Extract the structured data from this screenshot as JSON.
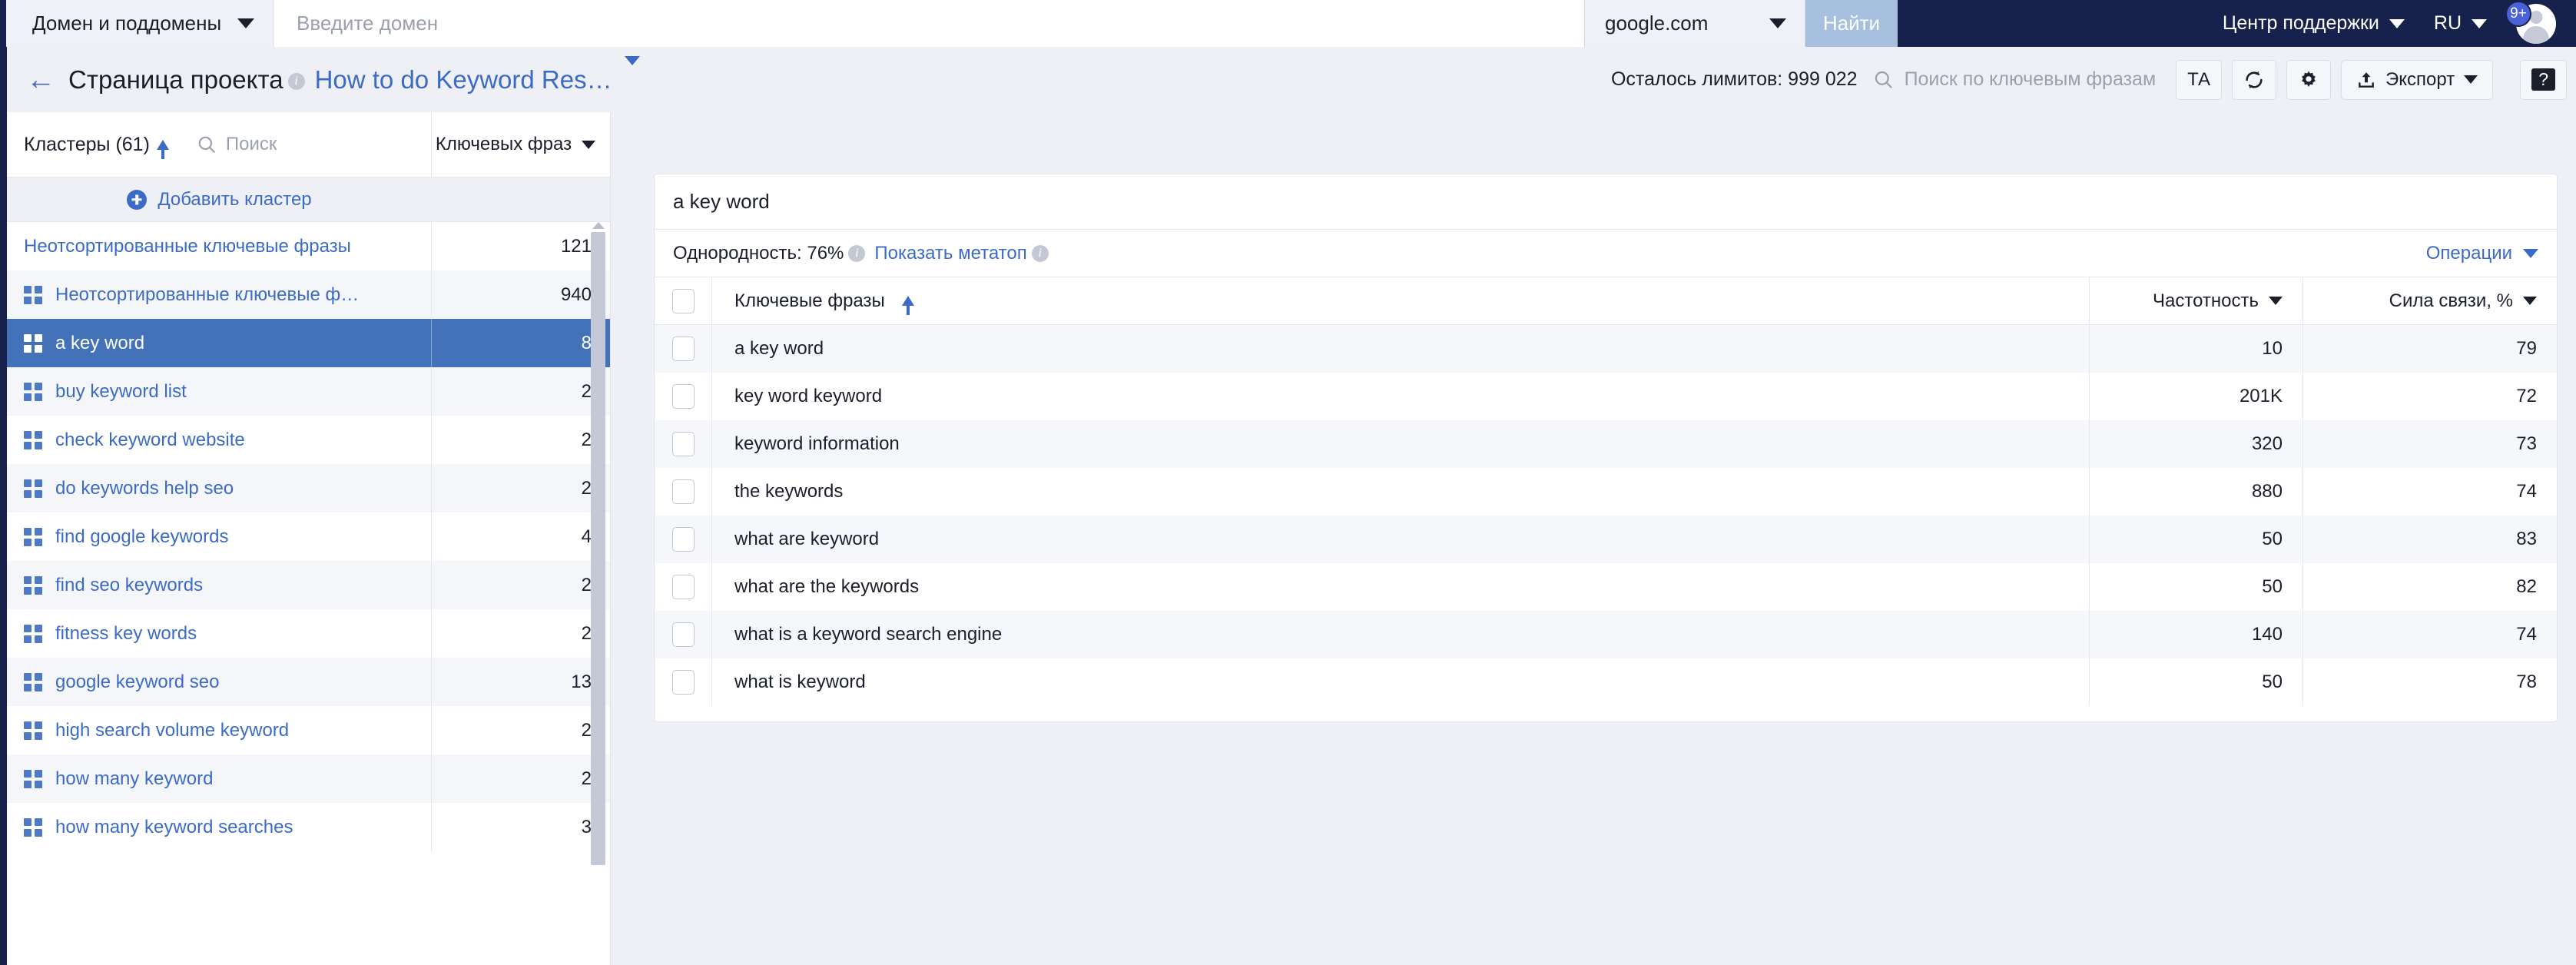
{
  "topbar": {
    "domain_mode": "Домен и поддомены",
    "domain_placeholder": "Введите домен",
    "domain_value": "",
    "search_engine": "google.com",
    "find_label": "Найти",
    "support_label": "Центр поддержки",
    "language": "RU",
    "notifications_badge": "9+"
  },
  "toolbar": {
    "back_icon": "←",
    "page_title": "Страница проекта",
    "project_name": "How to do Keyword Res…",
    "limits_label": "Осталось лимитов: 999 022",
    "keyword_search_placeholder": "Поиск по ключевым фразам",
    "ta_button": "ТА",
    "refresh_icon": "refresh-icon",
    "settings_icon": "gear-icon",
    "export_label": "Экспорт",
    "help_label": "?"
  },
  "sidebar": {
    "clusters_title": "Кластеры (61)",
    "search_placeholder": "Поиск",
    "count_column_label": "Ключевых фраз",
    "add_cluster_label": "Добавить кластер",
    "items": [
      {
        "label": "Неотсортированные ключевые фразы",
        "count": "121",
        "icon": false,
        "selected": false
      },
      {
        "label": "Неотсортированные ключевые ф…",
        "count": "940",
        "icon": true,
        "selected": false
      },
      {
        "label": "a key word",
        "count": "8",
        "icon": true,
        "selected": true
      },
      {
        "label": "buy keyword list",
        "count": "2",
        "icon": true,
        "selected": false
      },
      {
        "label": "check keyword website",
        "count": "2",
        "icon": true,
        "selected": false
      },
      {
        "label": "do keywords help seo",
        "count": "2",
        "icon": true,
        "selected": false
      },
      {
        "label": "find google keywords",
        "count": "4",
        "icon": true,
        "selected": false
      },
      {
        "label": "find seo keywords",
        "count": "2",
        "icon": true,
        "selected": false
      },
      {
        "label": "fitness key words",
        "count": "2",
        "icon": true,
        "selected": false
      },
      {
        "label": "google keyword seo",
        "count": "13",
        "icon": true,
        "selected": false
      },
      {
        "label": "high search volume keyword",
        "count": "2",
        "icon": true,
        "selected": false
      },
      {
        "label": "how many keyword",
        "count": "2",
        "icon": true,
        "selected": false
      },
      {
        "label": "how many keyword searches",
        "count": "3",
        "icon": true,
        "selected": false
      }
    ]
  },
  "main": {
    "cluster_title": "a key word",
    "homogeneity_label": "Однородность: 76%",
    "metatop_label": "Показать метатоп",
    "operations_label": "Операции",
    "columns": {
      "keyword": "Ключевые фразы",
      "frequency": "Частотность",
      "strength": "Сила связи, %"
    },
    "rows": [
      {
        "keyword": "a key word",
        "frequency": "10",
        "strength": "79"
      },
      {
        "keyword": "key word keyword",
        "frequency": "201K",
        "strength": "72"
      },
      {
        "keyword": "keyword information",
        "frequency": "320",
        "strength": "73"
      },
      {
        "keyword": "the keywords",
        "frequency": "880",
        "strength": "74"
      },
      {
        "keyword": "what are keyword",
        "frequency": "50",
        "strength": "83"
      },
      {
        "keyword": "what are the keywords",
        "frequency": "50",
        "strength": "82"
      },
      {
        "keyword": "what is a keyword search engine",
        "frequency": "140",
        "strength": "74"
      },
      {
        "keyword": "what is keyword",
        "frequency": "50",
        "strength": "78"
      }
    ]
  },
  "colors": {
    "navy": "#16224b",
    "accent_blue": "#3b6bc4",
    "selected_row": "#4472b9",
    "badge_blue": "#4a62d8"
  }
}
